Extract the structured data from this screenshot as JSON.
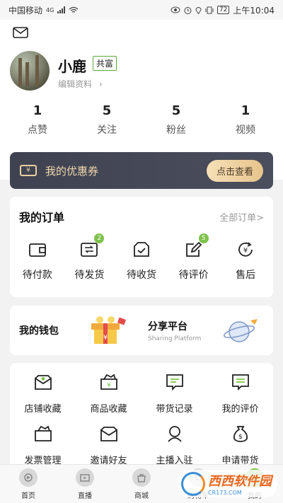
{
  "status_bar": {
    "carrier": "中国移动",
    "network": "4G",
    "battery": "72",
    "time": "上午10:04"
  },
  "profile": {
    "username": "小鹿",
    "badge": "共富",
    "edit_label": "编辑资料"
  },
  "stats": [
    {
      "value": "1",
      "label": "点赞"
    },
    {
      "value": "5",
      "label": "关注"
    },
    {
      "value": "5",
      "label": "粉丝"
    },
    {
      "value": "1",
      "label": "视频"
    }
  ],
  "coupon": {
    "icon_text": "¥",
    "label": "我的优惠券",
    "button": "点击查看"
  },
  "orders": {
    "title": "我的订单",
    "more": "全部订单>",
    "items": [
      {
        "label": "待付款",
        "icon": "wallet-icon",
        "badge": ""
      },
      {
        "label": "待发货",
        "icon": "shipping-box-icon",
        "badge": "2"
      },
      {
        "label": "待收货",
        "icon": "receive-box-icon",
        "badge": ""
      },
      {
        "label": "待评价",
        "icon": "edit-review-icon",
        "badge": "5"
      },
      {
        "label": "售后",
        "icon": "refund-icon",
        "badge": ""
      }
    ]
  },
  "wallet": {
    "title": "我的钱包",
    "share_title": "分享平台",
    "share_sub": "Sharing Platform",
    "gift_text": "¥"
  },
  "tools": [
    {
      "label": "店铺收藏",
      "icon": "shop-favorite-icon"
    },
    {
      "label": "商品收藏",
      "icon": "goods-favorite-icon"
    },
    {
      "label": "带货记录",
      "icon": "sales-record-icon"
    },
    {
      "label": "我的评价",
      "icon": "my-review-icon"
    },
    {
      "label": "发票管理",
      "icon": "invoice-icon"
    },
    {
      "label": "邀请好友",
      "icon": "invite-friend-icon"
    },
    {
      "label": "主播入驻",
      "icon": "anchor-join-icon"
    },
    {
      "label": "申请带货",
      "icon": "apply-sales-icon"
    }
  ],
  "tabbar": [
    {
      "label": "首页",
      "icon": "home-icon"
    },
    {
      "label": "直播",
      "icon": "live-icon"
    },
    {
      "label": "商城",
      "icon": "mall-icon"
    },
    {
      "label": "购物车",
      "icon": "cart-icon"
    },
    {
      "label": "我的",
      "icon": "profile-icon",
      "active": true
    }
  ],
  "watermark": {
    "text": "西西软件园",
    "sub": "CR173.COM"
  },
  "colors": {
    "accent": "#7ec24b",
    "coupon_bg": "#3f4250",
    "coupon_text": "#f0d9ae",
    "coupon_button": "#e7c48d"
  }
}
